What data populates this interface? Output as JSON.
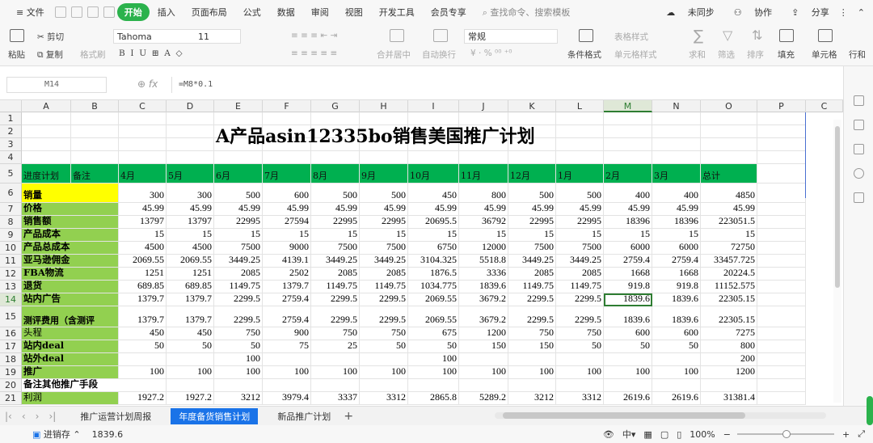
{
  "menubar": {
    "file": "≡ 文件",
    "items": [
      "开始",
      "插入",
      "页面布局",
      "公式",
      "数据",
      "审阅",
      "视图",
      "开发工具",
      "会员专享"
    ],
    "search": "查找命令、搜索模板",
    "sync": "未同步",
    "collab": "协作",
    "share": "分享"
  },
  "ribbon": {
    "cut": "剪切",
    "paste": "粘贴",
    "copy": "复制",
    "format_painter": "格式刷",
    "font": "Tahoma",
    "size": "11",
    "merge": "合并居中",
    "wrap": "自动换行",
    "number_format": "常规",
    "cond_format": "条件格式",
    "table_style": "表格样式",
    "cell_style": "单元格样式",
    "sum": "求和",
    "filter": "筛选",
    "sort": "排序",
    "fill": "填充",
    "cell": "单元格",
    "rowcol": "行和"
  },
  "formula_bar": {
    "name_box": "M14",
    "fx": "fx",
    "formula": "=M8*0.1"
  },
  "sheet": {
    "columns": [
      "A",
      "B",
      "C",
      "D",
      "E",
      "F",
      "G",
      "H",
      "I",
      "J",
      "K",
      "L",
      "M",
      "N",
      "O",
      "P",
      "C"
    ],
    "title": "A产品asin12335bo销售美国推广计划",
    "header_row": [
      "进度计划",
      "备注",
      "4月",
      "5月",
      "6月",
      "7月",
      "8月",
      "9月",
      "10月",
      "11月",
      "12月",
      "1月",
      "2月",
      "3月",
      "总计"
    ],
    "rows": [
      {
        "n": "6",
        "label": "销量",
        "v": [
          "300",
          "300",
          "500",
          "600",
          "500",
          "500",
          "450",
          "800",
          "500",
          "500",
          "400",
          "400",
          "4850"
        ]
      },
      {
        "n": "7",
        "label": "价格",
        "v": [
          "45.99",
          "45.99",
          "45.99",
          "45.99",
          "45.99",
          "45.99",
          "45.99",
          "45.99",
          "45.99",
          "45.99",
          "45.99",
          "45.99",
          "45.99"
        ]
      },
      {
        "n": "8",
        "label": "销售额",
        "v": [
          "13797",
          "13797",
          "22995",
          "27594",
          "22995",
          "22995",
          "20695.5",
          "36792",
          "22995",
          "22995",
          "18396",
          "18396",
          "223051.5"
        ]
      },
      {
        "n": "9",
        "label": "产品成本",
        "v": [
          "15",
          "15",
          "15",
          "15",
          "15",
          "15",
          "15",
          "15",
          "15",
          "15",
          "15",
          "15",
          "15"
        ]
      },
      {
        "n": "10",
        "label": "产品总成本",
        "v": [
          "4500",
          "4500",
          "7500",
          "9000",
          "7500",
          "7500",
          "6750",
          "12000",
          "7500",
          "7500",
          "6000",
          "6000",
          "72750"
        ]
      },
      {
        "n": "11",
        "label": "亚马逊佣金",
        "v": [
          "2069.55",
          "2069.55",
          "3449.25",
          "4139.1",
          "3449.25",
          "3449.25",
          "3104.325",
          "5518.8",
          "3449.25",
          "3449.25",
          "2759.4",
          "2759.4",
          "33457.725"
        ]
      },
      {
        "n": "12",
        "label": "FBA物流",
        "v": [
          "1251",
          "1251",
          "2085",
          "2502",
          "2085",
          "2085",
          "1876.5",
          "3336",
          "2085",
          "2085",
          "1668",
          "1668",
          "20224.5"
        ]
      },
      {
        "n": "13",
        "label": "退货",
        "v": [
          "689.85",
          "689.85",
          "1149.75",
          "1379.7",
          "1149.75",
          "1149.75",
          "1034.775",
          "1839.6",
          "1149.75",
          "1149.75",
          "919.8",
          "919.8",
          "11152.575"
        ]
      },
      {
        "n": "14",
        "label": "站内广告",
        "v": [
          "1379.7",
          "1379.7",
          "2299.5",
          "2759.4",
          "2299.5",
          "2299.5",
          "2069.55",
          "3679.2",
          "2299.5",
          "2299.5",
          "1839.6",
          "1839.6",
          "22305.15"
        ]
      },
      {
        "n": "15",
        "label": "测评费用（含测评",
        "v": [
          "1379.7",
          "1379.7",
          "2299.5",
          "2759.4",
          "2299.5",
          "2299.5",
          "2069.55",
          "3679.2",
          "2299.5",
          "2299.5",
          "1839.6",
          "1839.6",
          "22305.15"
        ]
      },
      {
        "n": "16",
        "label": "头程",
        "v": [
          "450",
          "450",
          "750",
          "900",
          "750",
          "750",
          "675",
          "1200",
          "750",
          "750",
          "600",
          "600",
          "7275"
        ]
      },
      {
        "n": "17",
        "label": "站内deal",
        "v": [
          "50",
          "50",
          "50",
          "75",
          "25",
          "50",
          "50",
          "150",
          "150",
          "50",
          "50",
          "50",
          "800"
        ]
      },
      {
        "n": "18",
        "label": "站外deal",
        "v": [
          "",
          "",
          "100",
          "",
          "",
          "",
          "100",
          "",
          "",
          "",
          "",
          "",
          "200"
        ]
      },
      {
        "n": "19",
        "label": "推广",
        "v": [
          "100",
          "100",
          "100",
          "100",
          "100",
          "100",
          "100",
          "100",
          "100",
          "100",
          "100",
          "100",
          "1200"
        ]
      },
      {
        "n": "20",
        "label": "备注其他推广手段",
        "v": [
          "",
          "",
          "",
          "",
          "",
          "",
          "",
          "",
          "",
          "",
          "",
          "",
          ""
        ]
      },
      {
        "n": "21",
        "label": "利润",
        "v": [
          "1927.2",
          "1927.2",
          "3212",
          "3979.4",
          "3337",
          "3312",
          "2865.8",
          "5289.2",
          "3212",
          "3312",
          "2619.6",
          "2619.6",
          "31381.4"
        ]
      }
    ],
    "row_numbers_top": [
      "1",
      "2",
      "3",
      "4",
      "5"
    ]
  },
  "tabs": {
    "items": [
      "推广运营计划周报",
      "年度备货销售计划",
      "新品推广计划"
    ],
    "active": 1,
    "add": "+"
  },
  "status": {
    "mode": "进销存",
    "value": "1839.6",
    "zoom": "100%"
  }
}
